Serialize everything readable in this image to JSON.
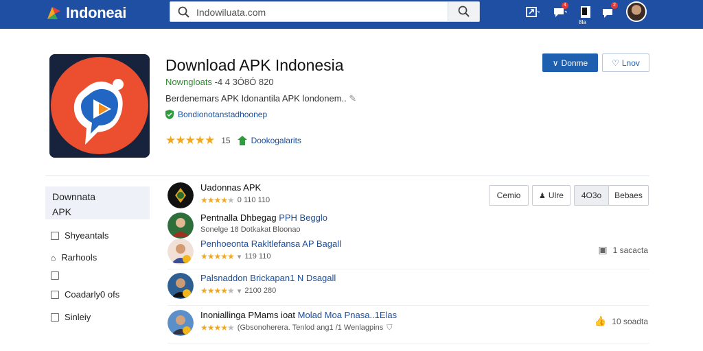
{
  "header": {
    "logo_text": "Indoneai",
    "search_value": "Indowiluata.com",
    "account_count": "8la",
    "badge_1": "4",
    "badge_2": "2"
  },
  "app": {
    "title": "Download APK Indonesia",
    "downloads_label": "Nowngloats",
    "downloads_count": "-4 4 3Ó8Ó 820",
    "description": "Berdenemars APK Idonantila APK londonem.. ",
    "verified": "Bondionotanstadhoonep",
    "rating_count": "15",
    "category": "Dookogalarits",
    "primary_button": "Donme",
    "outline_button": "Lnov"
  },
  "sidebar": {
    "heading_line1": "Downnata",
    "heading_line2": "APK",
    "items": [
      {
        "label": "Shyeantals"
      },
      {
        "label": "Rarhools"
      },
      {
        "label": ""
      },
      {
        "label": "Coadarly0 ofs"
      },
      {
        "label": "Sinleiy"
      }
    ]
  },
  "filters": [
    {
      "label": "Cemio"
    },
    {
      "label": "Ulre"
    },
    {
      "label": "4O3o"
    },
    {
      "label": "Bebaes"
    }
  ],
  "list": [
    {
      "name_plain": "Uadonnas APK",
      "name_blue": "",
      "rating_text": "0 110 110",
      "right": ""
    },
    {
      "name_plain": "Pentnalla Dhbegag ",
      "name_blue": "PPH Begglo",
      "rating_text": "Sonelge 18 Dotkakat Bloonao",
      "right": ""
    },
    {
      "name_plain": "",
      "name_blue": "Penhoeonta Rakltlefansa AP Bagall",
      "rating_text": "119 110",
      "right": "1 sacacta"
    },
    {
      "name_plain": "",
      "name_blue": "Palsnaddon Brickapan1 N Dsagall",
      "rating_text": "2100 280",
      "right": ""
    },
    {
      "name_plain": "Inoniallinga PMams ioat ",
      "name_blue": "Molad Moa Pnasa..1Elas",
      "rating_text": "(Gbsonoherera. Tenlod ang1 /1 Wenlagpins",
      "right": "10 soadta"
    }
  ]
}
